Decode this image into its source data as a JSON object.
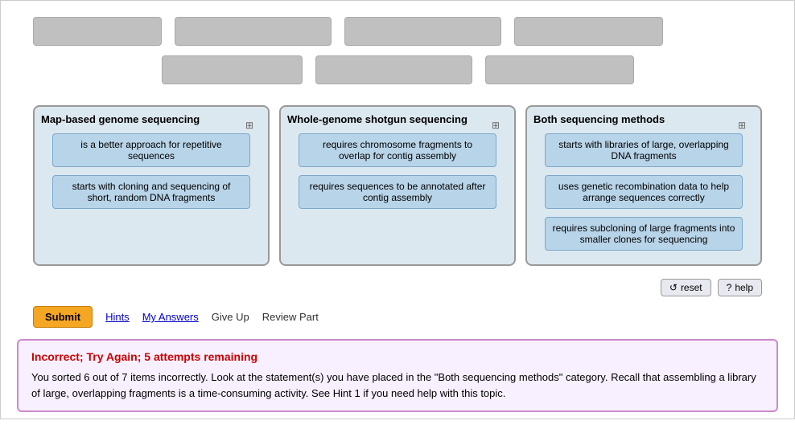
{
  "dragItems": {
    "row1": [
      {
        "id": "di1",
        "label": ""
      },
      {
        "id": "di2",
        "label": ""
      },
      {
        "id": "di3",
        "label": ""
      },
      {
        "id": "di4",
        "label": ""
      }
    ],
    "row2": [
      {
        "id": "di5",
        "label": ""
      },
      {
        "id": "di6",
        "label": ""
      },
      {
        "id": "di7",
        "label": ""
      }
    ]
  },
  "categories": [
    {
      "id": "cat1",
      "title": "Map-based genome sequencing",
      "items": [
        "is a better approach for repetitive sequences",
        "starts with cloning and sequencing of short, random DNA fragments"
      ]
    },
    {
      "id": "cat2",
      "title": "Whole-genome shotgun sequencing",
      "items": [
        "requires chromosome fragments to overlap for contig assembly",
        "requires sequences to be annotated after contig assembly"
      ]
    },
    {
      "id": "cat3",
      "title": "Both sequencing methods",
      "items": [
        "starts with libraries of large, overlapping DNA fragments",
        "uses genetic recombination data to help arrange sequences correctly",
        "requires subcloning of large fragments into smaller clones for sequencing"
      ]
    }
  ],
  "buttons": {
    "reset": "reset",
    "help": "help",
    "submit": "Submit",
    "hints": "Hints",
    "myAnswers": "My Answers",
    "giveUp": "Give Up",
    "reviewPart": "Review Part"
  },
  "feedback": {
    "title": "Incorrect; Try Again; 5 attempts remaining",
    "text": "You sorted 6 out of 7 items incorrectly. Look at the statement(s) you have placed in the \"Both sequencing methods\" category. Recall that assembling a library of large, overlapping fragments is a time-consuming activity. See Hint 1 if you need help with this topic."
  }
}
